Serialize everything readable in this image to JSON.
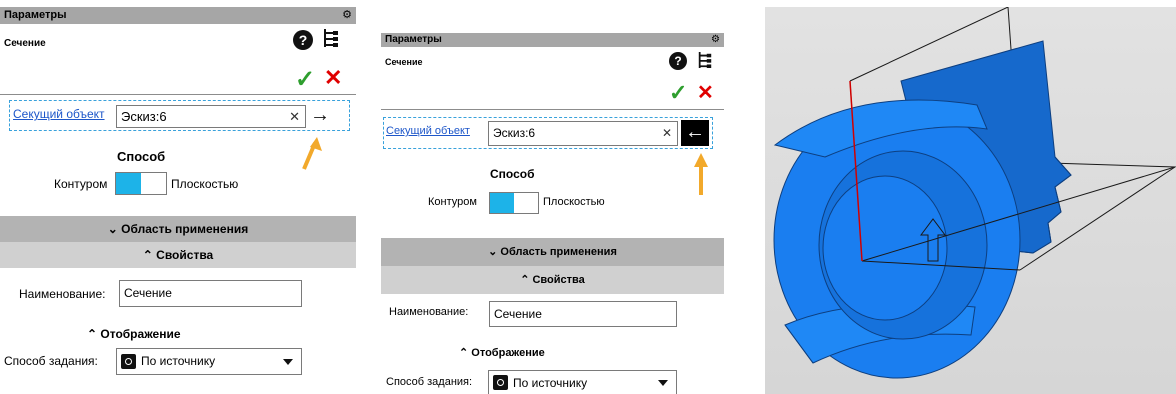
{
  "panel": {
    "title": "Параметры",
    "operation": "Сечение",
    "gear_icon": "gear-icon",
    "help_icon": "help-icon",
    "tree_icon": "tree-icon",
    "ok_symbol": "✓",
    "cancel_symbol": "✕",
    "cutting_object_label": "Секущий объект",
    "cutting_object_value": "Эскиз:6",
    "clear_symbol": "✕",
    "method_label": "Способ",
    "method_left": "Контуром",
    "method_right": "Плоскостью",
    "section_scope": "Область применения",
    "section_properties": "Свойства",
    "name_label": "Наименование:",
    "name_value": "Сечение",
    "display_label": "Отображение",
    "assign_method_label": "Способ задания:",
    "assign_method_value": "По источнику"
  },
  "panels": [
    {
      "arrow_symbol": "→",
      "arrow_direction": "forward"
    },
    {
      "arrow_symbol": "←",
      "arrow_direction": "backward"
    }
  ],
  "colors": {
    "accent": "#1db3e8",
    "link": "#1d56c9",
    "ok": "#2e9e2e",
    "cancel": "#e00000",
    "pointer": "#f2a92b",
    "model": "#1a7ef0"
  }
}
